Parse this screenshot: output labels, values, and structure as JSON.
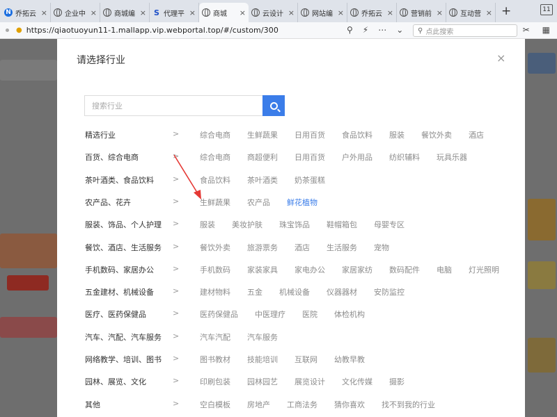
{
  "browser": {
    "tabs": [
      {
        "label": "乔拓云",
        "icon": "n-logo-icon",
        "active": false
      },
      {
        "label": "企业中",
        "icon": "globe-icon",
        "active": false
      },
      {
        "label": "商城编",
        "icon": "globe-icon",
        "active": false
      },
      {
        "label": "代理平",
        "icon": "s-logo-icon",
        "active": false
      },
      {
        "label": "商城",
        "icon": "globe-icon",
        "active": true
      },
      {
        "label": "云设计",
        "icon": "globe-icon",
        "active": false
      },
      {
        "label": "网站编",
        "icon": "globe-icon",
        "active": false
      },
      {
        "label": "乔拓云",
        "icon": "globe-icon",
        "active": false
      },
      {
        "label": "营销前",
        "icon": "globe-icon",
        "active": false
      },
      {
        "label": "互动营",
        "icon": "globe-icon",
        "active": false
      }
    ],
    "tab_close": "×",
    "new_tab": "+",
    "window_count": "11",
    "url": "https://qiaotuoyun11-1.mallapp.vip.webportal.top/#/custom/300",
    "search_placeholder": "点此搜索"
  },
  "modal": {
    "title": "请选择行业",
    "close": "×",
    "search_placeholder": "搜索行业",
    "chevron": ">",
    "rows": [
      {
        "category": "精选行业",
        "items": [
          "综合电商",
          "生鲜蔬果",
          "日用百货",
          "食品饮料",
          "服装",
          "餐饮外卖",
          "酒店"
        ]
      },
      {
        "category": "百货、综合电商",
        "items": [
          "综合电商",
          "商超便利",
          "日用百货",
          "户外用品",
          "纺织辅料",
          "玩具乐器"
        ]
      },
      {
        "category": "茶叶酒类、食品饮料",
        "items": [
          "食品饮料",
          "茶叶酒类",
          "奶茶蛋糕"
        ]
      },
      {
        "category": "农产品、花卉",
        "items": [
          "生鲜蔬果",
          "农产品",
          "鲜花植物"
        ]
      },
      {
        "category": "服装、饰品、个人护理",
        "items": [
          "服装",
          "美妆护肤",
          "珠宝饰品",
          "鞋帽箱包",
          "母婴专区"
        ]
      },
      {
        "category": "餐饮、酒店、生活服务",
        "items": [
          "餐饮外卖",
          "旅游票务",
          "酒店",
          "生活服务",
          "宠物"
        ]
      },
      {
        "category": "手机数码、家居办公",
        "items": [
          "手机数码",
          "家装家具",
          "家电办公",
          "家居家纺",
          "数码配件",
          "电脑",
          "灯光照明"
        ]
      },
      {
        "category": "五金建材、机械设备",
        "items": [
          "建材物料",
          "五金",
          "机械设备",
          "仪器器材",
          "安防监控"
        ]
      },
      {
        "category": "医疗、医药保健品",
        "items": [
          "医药保健品",
          "中医理疗",
          "医院",
          "体检机构"
        ]
      },
      {
        "category": "汽车、汽配、汽车服务",
        "items": [
          "汽车汽配",
          "汽车服务"
        ]
      },
      {
        "category": "网络教学、培训、图书",
        "items": [
          "图书教材",
          "技能培训",
          "互联网",
          "幼教早教"
        ]
      },
      {
        "category": "园林、展览、文化",
        "items": [
          "印刷包装",
          "园林园艺",
          "展览设计",
          "文化传媒",
          "摄影"
        ]
      },
      {
        "category": "其他",
        "items": [
          "空白模板",
          "房地产",
          "工商法务",
          "猜你喜欢",
          "找不到我的行业"
        ]
      }
    ]
  },
  "colors": {
    "accent": "#3b7de9",
    "annotation_arrow": "#e53935"
  }
}
